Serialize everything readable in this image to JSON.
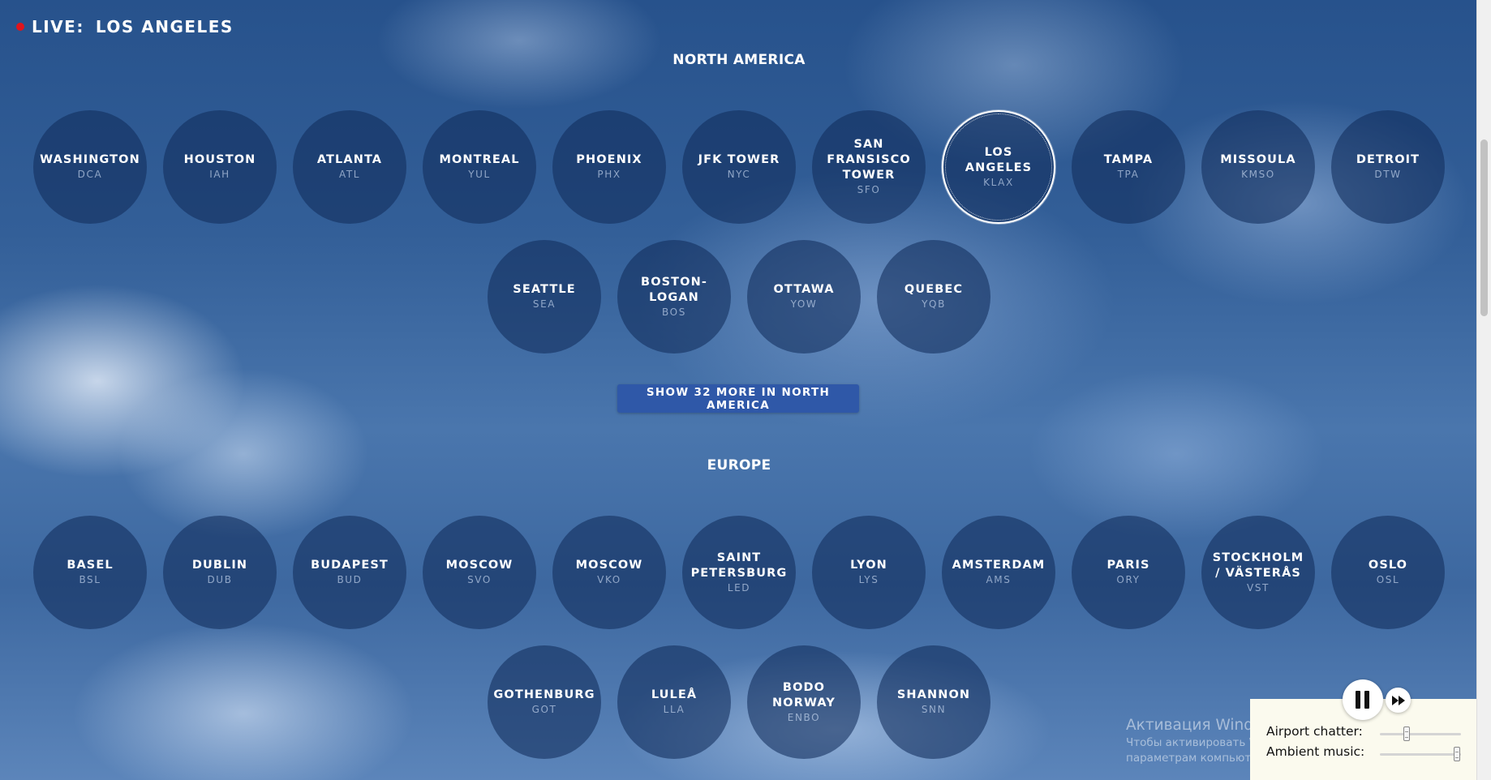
{
  "live": {
    "label": "LIVE:",
    "city": "LOS ANGELES"
  },
  "regions": [
    {
      "title": "NORTH AMERICA",
      "show_more_label": "SHOW 32 MORE IN NORTH AMERICA",
      "stations": [
        {
          "name": "WASHINGTON",
          "code": "DCA"
        },
        {
          "name": "HOUSTON",
          "code": "IAH"
        },
        {
          "name": "ATLANTA",
          "code": "ATL"
        },
        {
          "name": "MONTREAL",
          "code": "YUL"
        },
        {
          "name": "PHOENIX",
          "code": "PHX"
        },
        {
          "name": "JFK TOWER",
          "code": "NYC"
        },
        {
          "name": "SAN FRANSISCO TOWER",
          "code": "SFO"
        },
        {
          "name": "LOS ANGELES",
          "code": "KLAX",
          "active": true
        },
        {
          "name": "TAMPA",
          "code": "TPA"
        },
        {
          "name": "MISSOULA",
          "code": "KMSO"
        },
        {
          "name": "DETROIT",
          "code": "DTW"
        },
        {
          "name": "SEATTLE",
          "code": "SEA"
        },
        {
          "name": "BOSTON-LOGAN",
          "code": "BOS"
        },
        {
          "name": "OTTAWA",
          "code": "YOW"
        },
        {
          "name": "QUEBEC",
          "code": "YQB"
        }
      ]
    },
    {
      "title": "EUROPE",
      "stations": [
        {
          "name": "BASEL",
          "code": "BSL"
        },
        {
          "name": "DUBLIN",
          "code": "DUB"
        },
        {
          "name": "BUDAPEST",
          "code": "BUD"
        },
        {
          "name": "MOSCOW",
          "code": "SVO"
        },
        {
          "name": "MOSCOW",
          "code": "VKO"
        },
        {
          "name": "SAINT PETERSBURG",
          "code": "LED"
        },
        {
          "name": "LYON",
          "code": "LYS"
        },
        {
          "name": "AMSTERDAM",
          "code": "AMS"
        },
        {
          "name": "PARIS",
          "code": "ORY"
        },
        {
          "name": "STOCKHOLM / VÄSTERÅS",
          "code": "VST"
        },
        {
          "name": "OSLO",
          "code": "OSL"
        },
        {
          "name": "GOTHENBURG",
          "code": "GOT"
        },
        {
          "name": "LULEÅ",
          "code": "LLA"
        },
        {
          "name": "BODO NORWAY",
          "code": "ENBO"
        },
        {
          "name": "SHANNON",
          "code": "SNN"
        }
      ]
    }
  ],
  "audio": {
    "airport_chatter_label": "Airport chatter:",
    "airport_chatter_level": 0.29,
    "ambient_music_label": "Ambient music:",
    "ambient_music_level": 0.91,
    "state": "playing"
  },
  "watermark": {
    "title": "Активация Windows",
    "subtitle": "Чтобы активировать Windows, перейдите к параметрам компьютера."
  },
  "colors": {
    "live_dot": "#e0141c",
    "button": "#2f58a8",
    "panel_bg": "#fbfaee"
  }
}
